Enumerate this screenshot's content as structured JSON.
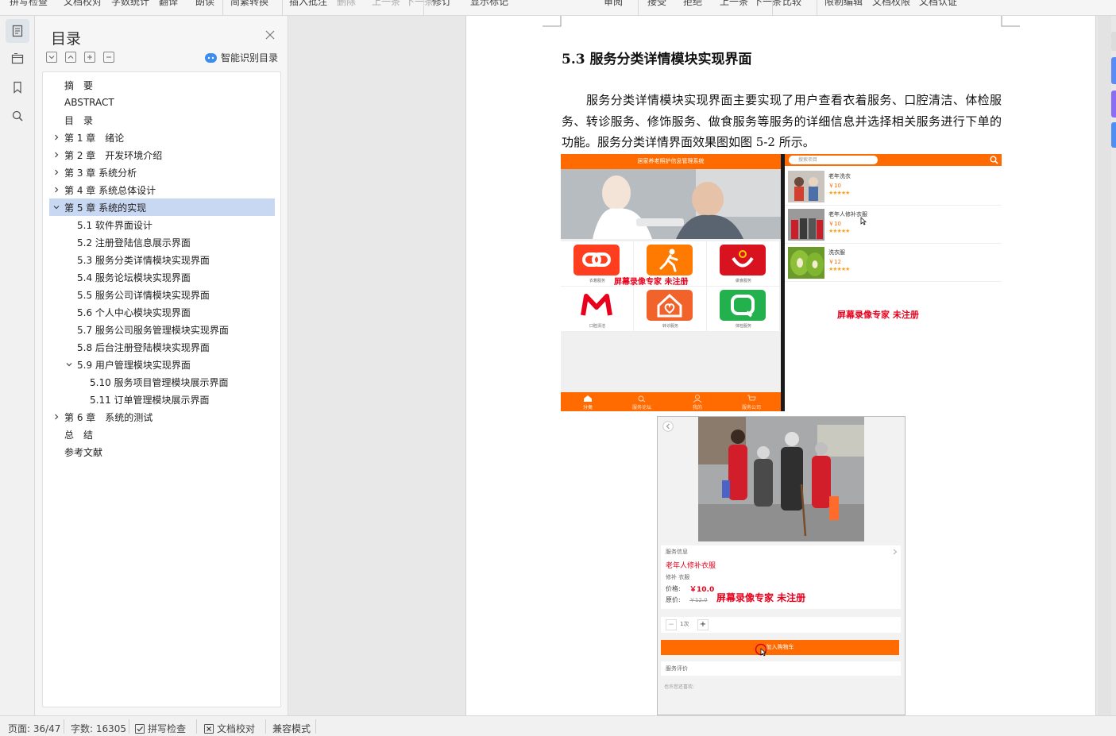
{
  "toolbar": {
    "items": [
      "拼写检查",
      "文档校对",
      "字数统计",
      "翻译",
      "朗读",
      "简繁转换",
      "插入批注",
      "删除",
      "上一条",
      "下一条",
      "修订",
      "显示标记",
      "审阅",
      "接受",
      "拒绝",
      "上一条",
      "下一条",
      "比较",
      "限制编辑",
      "文档权限",
      "文档认证"
    ]
  },
  "rail": {
    "icons": [
      "toc-icon",
      "outline-icon",
      "bookmark-icon",
      "search-icon"
    ]
  },
  "toc": {
    "title": "目录",
    "smart_label": "智能识别目录",
    "items": [
      {
        "label": "摘　要",
        "level": 0,
        "chevron": "none"
      },
      {
        "label": "ABSTRACT",
        "level": 0,
        "chevron": "none"
      },
      {
        "label": "目　录",
        "level": 0,
        "chevron": "none"
      },
      {
        "label": "第 1 章　绪论",
        "level": 0,
        "chevron": "right"
      },
      {
        "label": "第 2 章　开发环境介绍",
        "level": 0,
        "chevron": "right"
      },
      {
        "label": "第 3 章  系统分析",
        "level": 0,
        "chevron": "right"
      },
      {
        "label": "第 4 章  系统总体设计",
        "level": 0,
        "chevron": "right"
      },
      {
        "label": "第 5 章  系统的实现",
        "level": 0,
        "chevron": "down",
        "selected": true
      },
      {
        "label": "5.1  软件界面设计",
        "level": 1,
        "chevron": "none"
      },
      {
        "label": "5.2  注册登陆信息展示界面",
        "level": 1,
        "chevron": "none"
      },
      {
        "label": "5.3  服务分类详情模块实现界面",
        "level": 1,
        "chevron": "none"
      },
      {
        "label": "5.4  服务论坛模块实现界面",
        "level": 1,
        "chevron": "none"
      },
      {
        "label": "5.5 服务公司详情模块实现界面",
        "level": 1,
        "chevron": "none"
      },
      {
        "label": "5.6 个人中心模块实现界面",
        "level": 1,
        "chevron": "none"
      },
      {
        "label": "5.7 服务公司服务管理模块实现界面",
        "level": 1,
        "chevron": "none"
      },
      {
        "label": "5.8  后台注册登陆模块实现界面",
        "level": 1,
        "chevron": "none"
      },
      {
        "label": "5.9  用户管理模块实现界面",
        "level": 1,
        "chevron": "down"
      },
      {
        "label": "5.10  服务项目管理模块展示界面",
        "level": 2,
        "chevron": "none"
      },
      {
        "label": "5.11 订单管理模块展示界面",
        "level": 2,
        "chevron": "none"
      },
      {
        "label": "第 6 章　系统的测试",
        "level": 0,
        "chevron": "right"
      },
      {
        "label": "总　结",
        "level": 0,
        "chevron": "none"
      },
      {
        "label": "参考文献",
        "level": 0,
        "chevron": "none"
      }
    ]
  },
  "document": {
    "heading": "5.3  服务分类详情模块实现界面",
    "paragraph": "服务分类详情模块实现界面主要实现了用户查看衣着服务、口腔清洁、体检服务、转诊服务、修饰服务、做食服务等服务的详细信息并选择相关服务进行下单的功能。服务分类详情界面效果图如图 5-2 所示。"
  },
  "figure": {
    "watermark": "屏幕录像专家  未注册",
    "phone1": {
      "header": "居家养老照护信息管理系统",
      "tiles": [
        {
          "label": "衣着服务",
          "color": "#ff3d1f"
        },
        {
          "label": "",
          "color": "#ff7a00"
        },
        {
          "label": "做食服务",
          "color": "#d9121f"
        },
        {
          "label": "口腔清洁",
          "color": "#ffffff"
        },
        {
          "label": "转诊服务",
          "color": "#f2622b"
        },
        {
          "label": "体检服务",
          "color": "#22b14c"
        }
      ],
      "footer": [
        "分类",
        "服务论坛",
        "我的",
        "服务公司"
      ]
    },
    "phone2": {
      "search_placeholder": "搜索项目",
      "rows": [
        {
          "name": "老年洗衣",
          "price": "￥10",
          "stars": "★★★★★"
        },
        {
          "name": "老年人修补衣服",
          "price": "￥10",
          "stars": "★★★★★"
        },
        {
          "name": "洗衣服",
          "price": "￥12",
          "stars": "★★★★★"
        }
      ]
    },
    "detail": {
      "section_label": "服务信息",
      "service_name": "老年人修补衣服",
      "tag": "修补 衣服",
      "price_label": "价格:",
      "price": "￥10.0",
      "orig_label": "原价:",
      "orig_price": "￥12.0",
      "qty": "1次",
      "cart_button": "加入购物车",
      "review_label": "服务评价",
      "review_hint": "也许您还喜欢:"
    }
  },
  "status": {
    "page": "页面: 36/47",
    "words": "字数: 16305",
    "spell": "拼写检查",
    "proof": "文档校对",
    "compat": "兼容模式"
  },
  "colors": {
    "accent": "#ff6b00",
    "selection": "#c8d7f2",
    "watermark": "#e8001c"
  }
}
